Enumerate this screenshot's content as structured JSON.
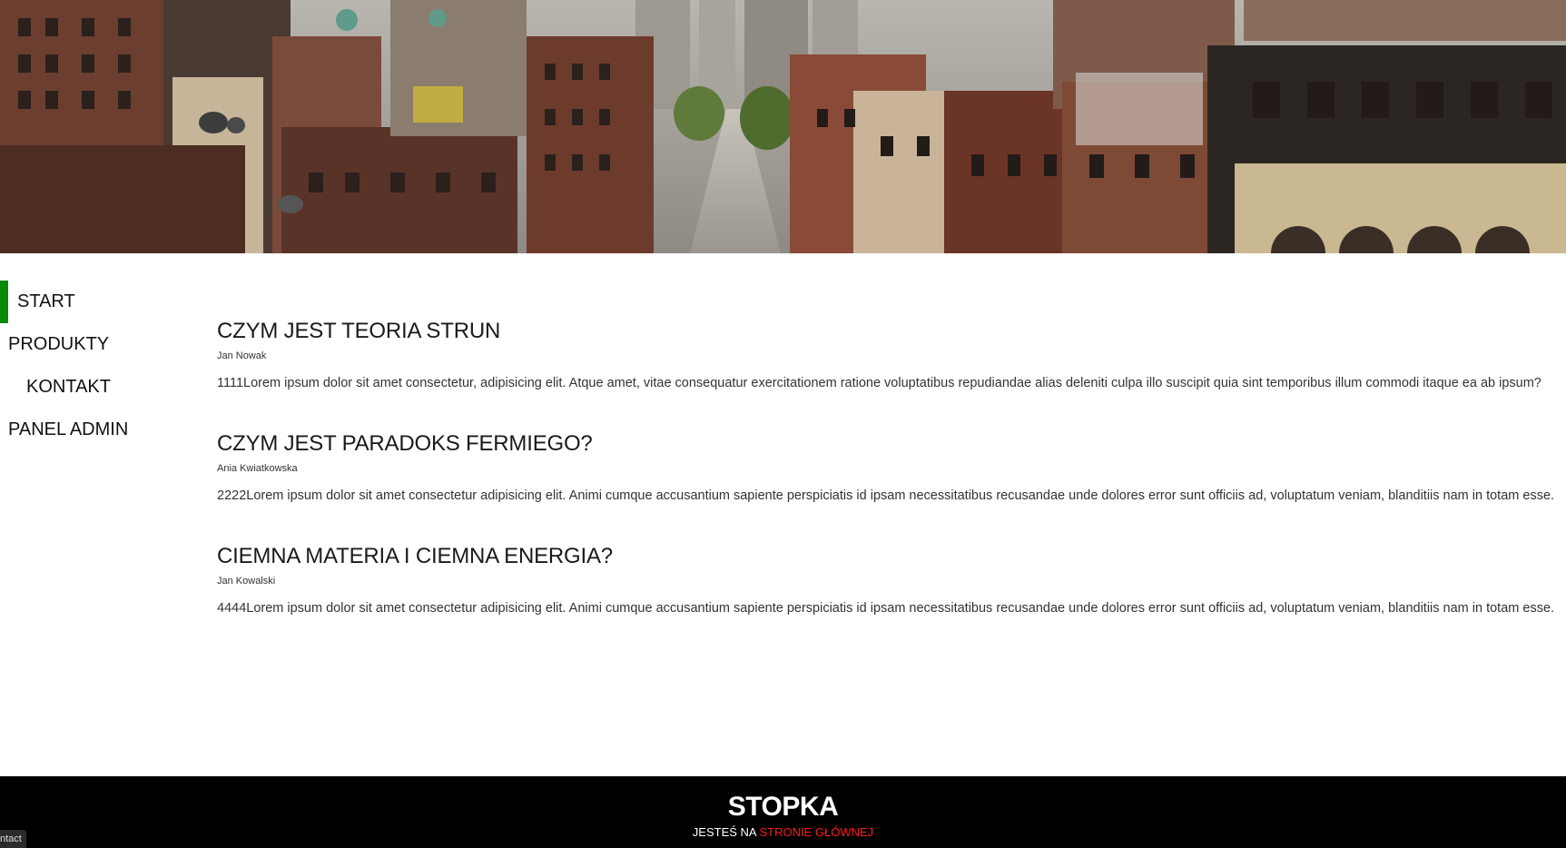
{
  "header": {
    "image_alt": "Widok ulicy miasta z kamienicami"
  },
  "nav": {
    "items": [
      {
        "label": "START",
        "active": true
      },
      {
        "label": "PRODUKTY",
        "active": false
      },
      {
        "label": "KONTAKT",
        "active": false
      },
      {
        "label": "PANEL ADMIN",
        "active": false
      }
    ]
  },
  "articles": [
    {
      "title": "CZYM JEST TEORIA STRUN",
      "author": "Jan Nowak",
      "body": "1111Lorem ipsum dolor sit amet consectetur, adipisicing elit. Atque amet, vitae consequatur exercitationem ratione voluptatibus repudiandae alias deleniti culpa illo suscipit quia sint temporibus illum commodi itaque ea ab ipsum?"
    },
    {
      "title": "CZYM JEST PARADOKS FERMIEGO?",
      "author": "Ania Kwiatkowska",
      "body": "2222Lorem ipsum dolor sit amet consectetur adipisicing elit. Animi cumque accusantium sapiente perspiciatis id ipsam necessitatibus recusandae unde dolores error sunt officiis ad, voluptatum veniam, blanditiis nam in totam esse."
    },
    {
      "title": "CIEMNA MATERIA I CIEMNA ENERGIA?",
      "author": "Jan Kowalski",
      "body": "4444Lorem ipsum dolor sit amet consectetur adipisicing elit. Animi cumque accusantium sapiente perspiciatis id ipsam necessitatibus recusandae unde dolores error sunt officiis ad, voluptatum veniam, blanditiis nam in totam esse."
    }
  ],
  "footer": {
    "title": "STOPKA",
    "note_prefix": "JESTEŚ NA",
    "note_highlight": "STRONIE GŁÓWNEJ"
  },
  "corner_tag": "ntact",
  "colors": {
    "active_indicator": "#0a8a0a",
    "footer_bg": "#000000",
    "footer_highlight": "#ff1a1a"
  }
}
